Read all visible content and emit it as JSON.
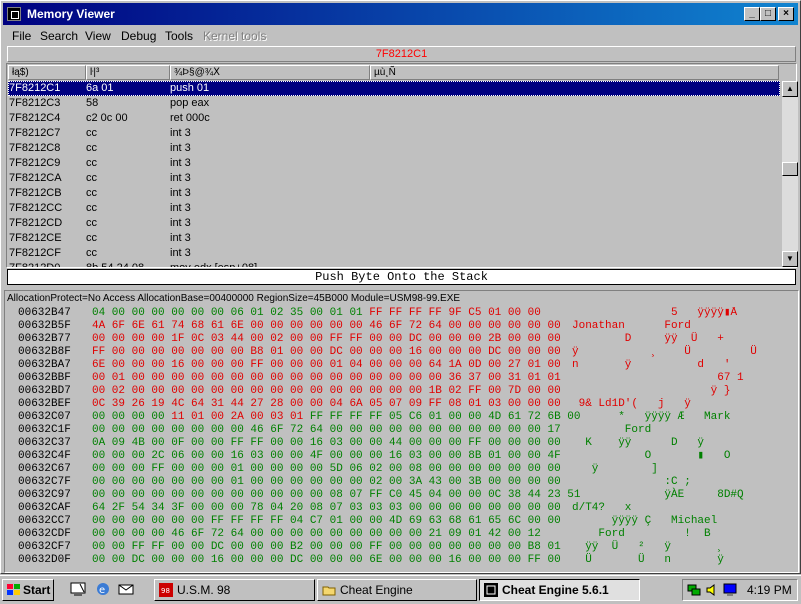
{
  "window": {
    "title": "Memory Viewer"
  },
  "menu": {
    "items": [
      "File",
      "Search",
      "View",
      "Debug",
      "Tools"
    ],
    "disabled_item": "Kernel tools"
  },
  "disassembler": {
    "current_address": "7F8212C1",
    "columns": [
      "łą$)",
      "ŀ|³",
      "¾Þ§@¾Ⅹ",
      "µù¸Ñ"
    ],
    "selected_index": 0,
    "rows": [
      {
        "address": "7F8212C1",
        "bytes": "6a 01",
        "opcode": "push 01"
      },
      {
        "address": "7F8212C3",
        "bytes": "58",
        "opcode": "pop eax"
      },
      {
        "address": "7F8212C4",
        "bytes": "c2 0c 00",
        "opcode": "ret 000c"
      },
      {
        "address": "7F8212C7",
        "bytes": "cc",
        "opcode": "int 3"
      },
      {
        "address": "7F8212C8",
        "bytes": "cc",
        "opcode": "int 3"
      },
      {
        "address": "7F8212C9",
        "bytes": "cc",
        "opcode": "int 3"
      },
      {
        "address": "7F8212CA",
        "bytes": "cc",
        "opcode": "int 3"
      },
      {
        "address": "7F8212CB",
        "bytes": "cc",
        "opcode": "int 3"
      },
      {
        "address": "7F8212CC",
        "bytes": "cc",
        "opcode": "int 3"
      },
      {
        "address": "7F8212CD",
        "bytes": "cc",
        "opcode": "int 3"
      },
      {
        "address": "7F8212CE",
        "bytes": "cc",
        "opcode": "int 3"
      },
      {
        "address": "7F8212CF",
        "bytes": "cc",
        "opcode": "int 3"
      },
      {
        "address": "7F8212D0",
        "bytes": "8b 54 24 08",
        "opcode": "mov edx,[esp+08]"
      }
    ]
  },
  "instruction_description": "Push Byte Onto the Stack",
  "hexview": {
    "allocation_info": "AllocationProtect=No Access  AllocationBase=00400000 RegionSize=45B000 Module=USM98-99.EXE",
    "colors": {
      "green": "#008000",
      "red": "#e00000"
    },
    "rows": [
      {
        "address": "00632B47",
        "green": "04 00 00 00 00 00 00 06 01 02 35 00 01 01 ",
        "red": "FF FF FF FF 9F C5 01 00 00",
        "ascii": "               5   ÿÿÿÿ▮Å",
        "ascii_color": "r"
      },
      {
        "address": "00632B5F",
        "green": "",
        "red": "4A 6F 6E 61 74 68 61 6E 00 00 00 00 00 00 46 6F 72 64 00 00 00 00 00 00",
        "ascii": "Jonathan      Ford",
        "ascii_color": "r"
      },
      {
        "address": "00632B77",
        "green": "",
        "red": "00 00 00 00 1F 0C 03 44 00 02 00 00 FF FF 00 00 DC 00 00 00 2B 00 00 00",
        "ascii": "        D     ÿÿ  Ü   +",
        "ascii_color": "r"
      },
      {
        "address": "00632B8F",
        "green": "",
        "red": "FF 00 00 00 00 00 00 00 B8 01 00 00 DC 00 00 00 16 00 00 00 DC 00 00 00",
        "ascii": "ÿ           ¸    Ü         Ü",
        "ascii_color": "r"
      },
      {
        "address": "00632BA7",
        "green": "",
        "red": "6E 00 00 00 16 00 00 00 FF 00 00 00 01 04 00 00 00 64 1A 0D 00 27 01 00",
        "ascii": "n       ÿ          d   '",
        "ascii_color": "r"
      },
      {
        "address": "00632BBF",
        "green": "",
        "red": "00 01 00 00 00 00 00 00 00 00 00 00 00 00 00 00 00 00 36 37 00 31 01 01",
        "ascii": "                      67 1",
        "ascii_color": "r"
      },
      {
        "address": "00632BD7",
        "green": "",
        "red": "00 02 00 00 00 00 00 00 00 00 00 00 00 00 00 00 00 1B 02 FF 00 7D 00 00",
        "ascii": "                     ÿ }",
        "ascii_color": "r"
      },
      {
        "address": "00632BEF",
        "green": "",
        "red": "0C 39 26 19 4C 64 31 44 27 28 00 00 04 6A 05 07 09 FF 08 01 03 00 00 00",
        "ascii": " 9& Ld1D'(   j   ÿ",
        "ascii_color": "r"
      },
      {
        "address": "00632C07",
        "green": "00 00 00 00 ",
        "red": "11 01 00 2A 00 03 01 ",
        "green2": "FF FF FF FF 05 C6 01 00 00 4D 61 72 6B 00",
        "ascii": "       *   ÿÿÿÿ Æ   Mark",
        "ascii_color": "g"
      },
      {
        "address": "00632C1F",
        "green": "00 00 00 00 00 00 00 00 46 6F 72 64 00 00 00 00 00 00 00 00 00 00 00 17",
        "red": "",
        "ascii": "        Ford",
        "ascii_color": "g"
      },
      {
        "address": "00632C37",
        "green": "0A 09 4B 00 0F 00 00 FF FF 00 00 16 03 00 00 44 00 00 00 FF 00 00 00 00",
        "red": "",
        "ascii": "  K    ÿÿ      D   ÿ",
        "ascii_color": "g"
      },
      {
        "address": "00632C4F",
        "green": "00 00 00 2C 06 00 00 16 03 00 00 4F 00 00 00 16 03 00 00 8B 01 00 00 4F",
        "red": "",
        "ascii": "           O       ▮   O",
        "ascii_color": "g"
      },
      {
        "address": "00632C67",
        "green": "00 00 00 FF 00 00 00 01 00 00 00 00 5D 06 02 00 08 00 00 00 00 00 00 00",
        "red": "",
        "ascii": "   ÿ        ]",
        "ascii_color": "g"
      },
      {
        "address": "00632C7F",
        "green": "00 00 00 00 00 00 00 01 00 00 00 00 00 00 02 00 3A 43 00 3B 00 00 00 00",
        "red": "",
        "ascii": "              :C ;",
        "ascii_color": "g"
      },
      {
        "address": "00632C97",
        "green": "00 00 00 00 00 00 00 00 00 00 00 00 08 07 FF C0 45 04 00 00 0C 38 44 23 51",
        "red": "",
        "ascii": "              ÿÀE     8D#Q",
        "ascii_color": "g"
      },
      {
        "address": "00632CAF",
        "green": "64 2F 54 34 3F 00 00 00 78 04 20 08 07 03 03 03 00 00 00 00 00 00 00 00",
        "red": "",
        "ascii": "d/T4?   x",
        "ascii_color": "g"
      },
      {
        "address": "00632CC7",
        "green": "00 00 00 00 00 00 FF FF FF FF 04 C7 01 00 00 4D 69 63 68 61 65 6C 00 00",
        "red": "",
        "ascii": "      ÿÿÿÿ Ç   Michael",
        "ascii_color": "g"
      },
      {
        "address": "00632CDF",
        "green": "00 00 00 00 46 6F 72 64 00 00 00 00 00 00 00 00 00 21 09 01 42 00 12",
        "red": "",
        "ascii": "    Ford         !  B",
        "ascii_color": "g"
      },
      {
        "address": "00632CF7",
        "green": "00 00 FF FF 00 00 DC 00 00 00 B2 00 00 00 FF 00 00 00 00 00 00 00 B8 01",
        "red": "",
        "ascii": "  ÿÿ  Ü   ²   ÿ       ¸",
        "ascii_color": "g"
      },
      {
        "address": "00632D0F",
        "green": "00 00 DC 00 00 00 16 00 00 00 DC 00 00 00 6E 00 00 00 16 00 00 00 FF 00",
        "red": "",
        "ascii": "  Ü       Ü   n       ÿ",
        "ascii_color": "g"
      }
    ]
  },
  "taskbar": {
    "start_label": "Start",
    "tasks": [
      {
        "label": "U.S.M. 98",
        "active": false
      },
      {
        "label": "Cheat Engine",
        "active": false
      },
      {
        "label": "Cheat Engine 5.6.1",
        "active": true
      }
    ],
    "clock": "4:19 PM"
  }
}
